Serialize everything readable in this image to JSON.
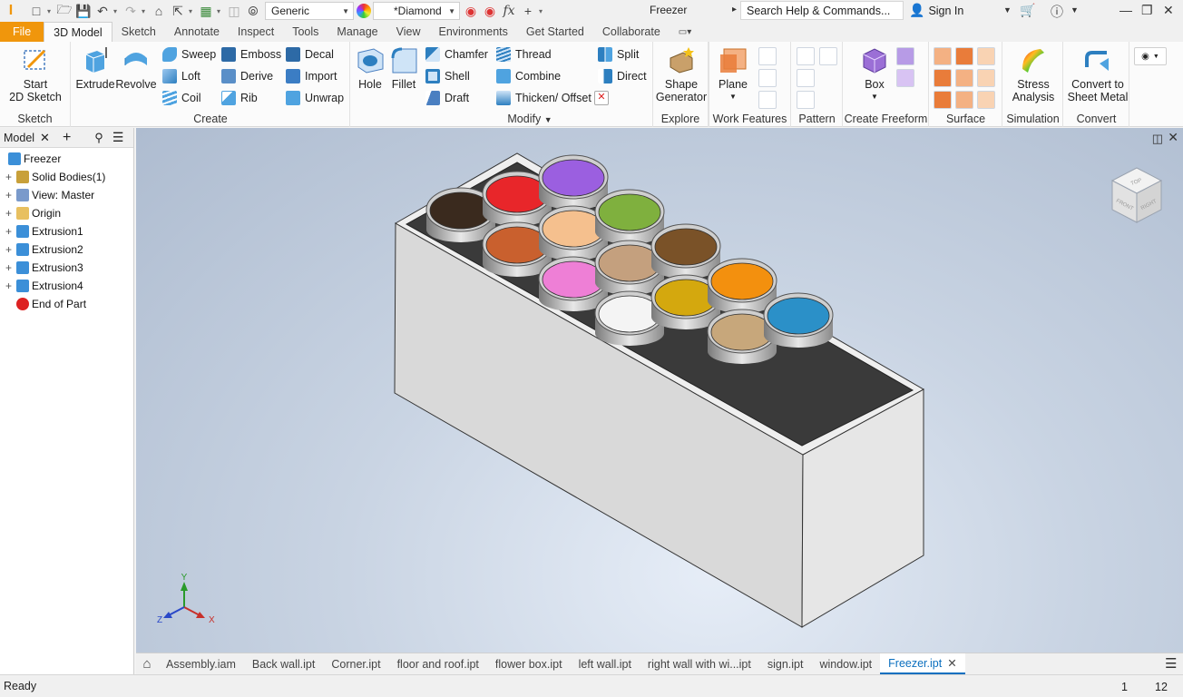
{
  "quick_access": {
    "appearance_select": "Generic",
    "material_select": "*Diamond",
    "app_title": "Freezer",
    "search_placeholder": "Search Help & Commands...",
    "signin_label": "Sign In"
  },
  "ribbon_tabs": [
    "File",
    "3D Model",
    "Sketch",
    "Annotate",
    "Inspect",
    "Tools",
    "Manage",
    "View",
    "Environments",
    "Get Started",
    "Collaborate"
  ],
  "active_tab": "3D Model",
  "ribbon": {
    "sketch": {
      "label": "Sketch",
      "start_sketch_line1": "Start",
      "start_sketch_line2": "2D Sketch"
    },
    "create": {
      "label": "Create",
      "extrude": "Extrude",
      "revolve": "Revolve",
      "sweep": "Sweep",
      "loft": "Loft",
      "coil": "Coil",
      "emboss": "Emboss",
      "derive": "Derive",
      "rib": "Rib",
      "decal": "Decal",
      "import": "Import",
      "unwrap": "Unwrap"
    },
    "modify": {
      "label": "Modify",
      "hole": "Hole",
      "fillet": "Fillet",
      "chamfer": "Chamfer",
      "shell": "Shell",
      "draft": "Draft",
      "thread": "Thread",
      "combine": "Combine",
      "thicken": "Thicken/ Offset",
      "split": "Split",
      "direct": "Direct"
    },
    "explore": {
      "label": "Explore",
      "shape_generator_line1": "Shape",
      "shape_generator_line2": "Generator"
    },
    "work_features": {
      "label": "Work Features",
      "plane": "Plane"
    },
    "pattern": {
      "label": "Pattern"
    },
    "freeform": {
      "label": "Create Freeform",
      "box": "Box"
    },
    "surface": {
      "label": "Surface"
    },
    "simulation": {
      "label": "Simulation",
      "stress_line1": "Stress",
      "stress_line2": "Analysis"
    },
    "convert": {
      "label": "Convert",
      "sheet_line1": "Convert to",
      "sheet_line2": "Sheet Metal"
    }
  },
  "browser": {
    "title": "Model",
    "items": [
      {
        "label": "Freezer",
        "level": 0
      },
      {
        "label": "Solid Bodies(1)",
        "level": 1
      },
      {
        "label": "View: Master",
        "level": 1
      },
      {
        "label": "Origin",
        "level": 1
      },
      {
        "label": "Extrusion1",
        "level": 1
      },
      {
        "label": "Extrusion2",
        "level": 1
      },
      {
        "label": "Extrusion3",
        "level": 1
      },
      {
        "label": "Extrusion4",
        "level": 1
      },
      {
        "label": "End of Part",
        "level": 1
      }
    ]
  },
  "viewcube": {
    "top": "TOP",
    "front": "FRONT",
    "right": "RIGHT"
  },
  "axes": {
    "x": "X",
    "y": "Y",
    "z": "Z"
  },
  "container_colors": {
    "row1": [
      "#3a2a1e",
      "#e8262a",
      "#9b5fe0"
    ],
    "row2": [
      "#c9602e",
      "#f5c08e",
      "#7fb03e"
    ],
    "row3": [
      "#ee7fd6",
      "#c4a07e",
      "#7a5228"
    ],
    "row4": [
      "#f4f4f4",
      "#d4a80e",
      "#f3900e"
    ],
    "row5": [
      "#c7a77b",
      "#2b90c8"
    ]
  },
  "doc_tabs": [
    "Assembly.iam",
    "Back wall.ipt",
    "Corner.ipt",
    "floor and roof.ipt",
    "flower box.ipt",
    "left wall.ipt",
    "right wall with wi...ipt",
    "sign.ipt",
    "window.ipt",
    "Freezer.ipt"
  ],
  "active_doc": "Freezer.ipt",
  "status": {
    "text": "Ready",
    "count1": "1",
    "count2": "12"
  }
}
